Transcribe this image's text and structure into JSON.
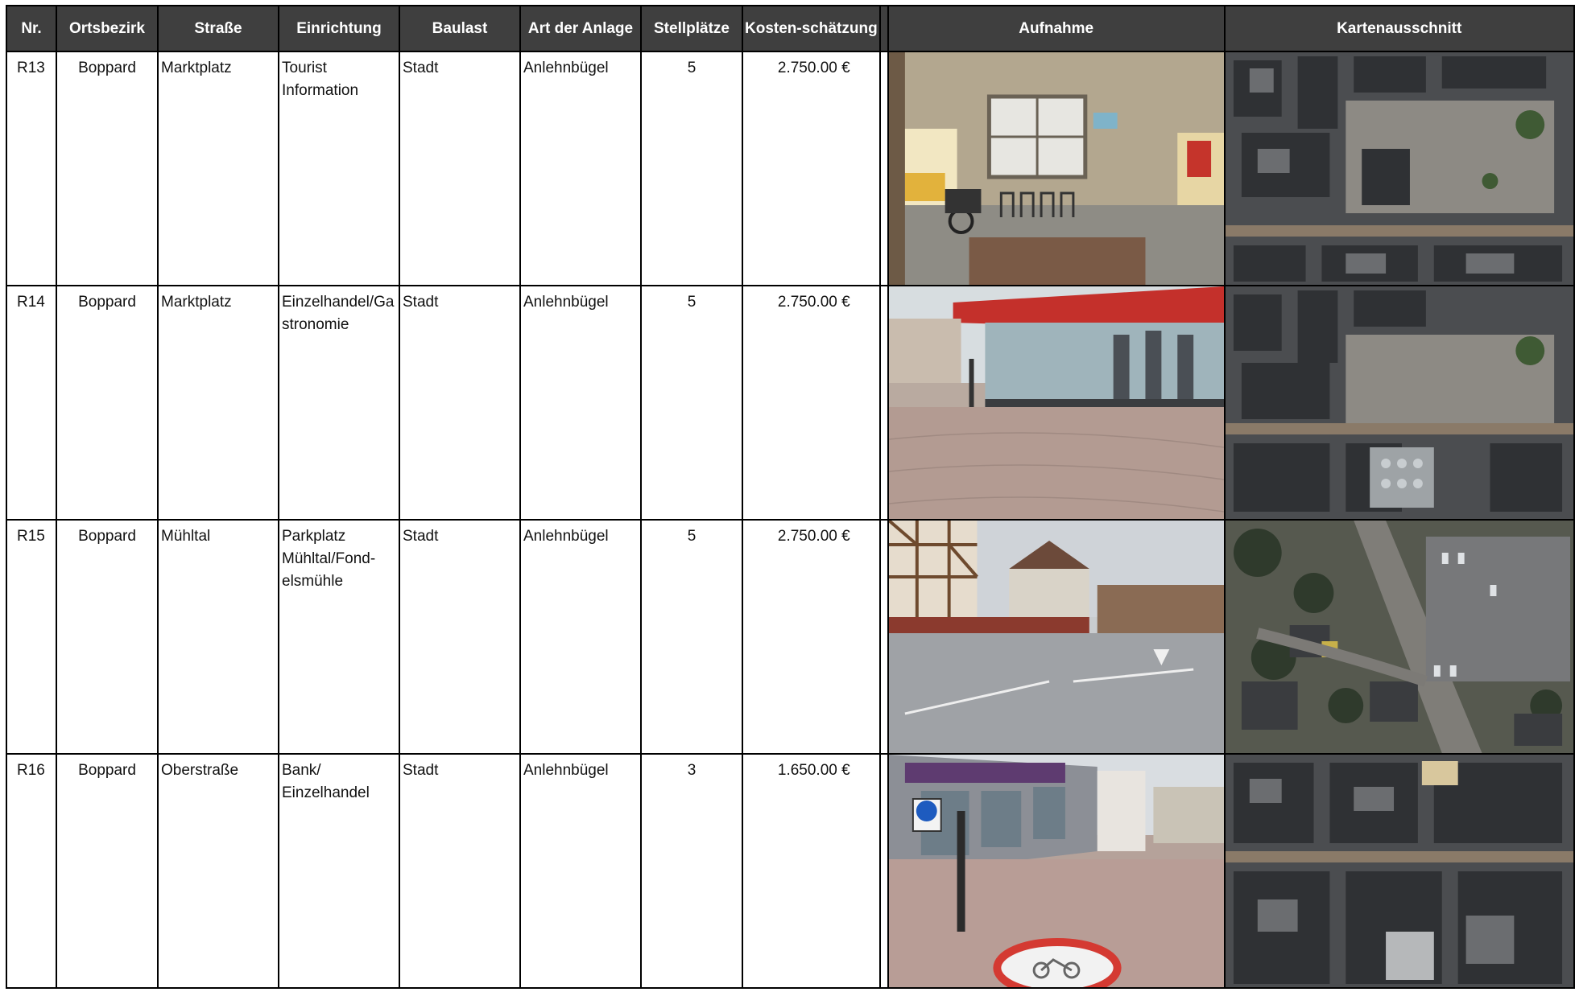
{
  "headers": {
    "nr": "Nr.",
    "ortsbezirk": "Ortsbezirk",
    "strasse": "Straße",
    "einrichtung": "Einrichtung",
    "baulast": "Baulast",
    "art": "Art der Anlage",
    "stellplaetze": "Stellplätze",
    "kosten": "Kosten-schätzung",
    "aufnahme": "Aufnahme",
    "karte": "Kartenausschnitt"
  },
  "rows": [
    {
      "nr": "R13",
      "ortsbezirk": "Boppard",
      "strasse": "Marktplatz",
      "einrichtung_lines": [
        "Tourist",
        "Information"
      ],
      "baulast": "Stadt",
      "art": "Anlehnbügel",
      "stellplaetze": "5",
      "kosten": "2.750.00 €",
      "photo_icon": "tourist-info-bike-rack-photo",
      "map_icon": "marktplatz-aerial-map"
    },
    {
      "nr": "R14",
      "ortsbezirk": "Boppard",
      "strasse": "Marktplatz",
      "einrichtung_lines": [
        "Einzelhandel/Ga",
        "stronomie"
      ],
      "baulast": "Stadt",
      "art": "Anlehnbügel",
      "stellplaetze": "5",
      "kosten": "2.750.00 €",
      "photo_icon": "shop-window-pavement-photo",
      "map_icon": "marktplatz-aerial-map"
    },
    {
      "nr": "R15",
      "ortsbezirk": "Boppard",
      "strasse": "Mühltal",
      "einrichtung_lines": [
        "Parkplatz",
        "Mühltal/Fond-",
        "elsmühle"
      ],
      "baulast": "Stadt",
      "art": "Anlehnbügel",
      "stellplaetze": "5",
      "kosten": "2.750.00 €",
      "photo_icon": "parking-lot-photo",
      "map_icon": "muehltal-aerial-map"
    },
    {
      "nr": "R16",
      "ortsbezirk": "Boppard",
      "strasse": "Oberstraße",
      "einrichtung_lines": [
        "Bank/",
        "Einzelhandel"
      ],
      "baulast": "Stadt",
      "art": "Anlehnbügel",
      "stellplaetze": "3",
      "kosten": "1.650.00 €",
      "photo_icon": "pedestrian-street-photo",
      "map_icon": "oberstrasse-aerial-map"
    }
  ]
}
